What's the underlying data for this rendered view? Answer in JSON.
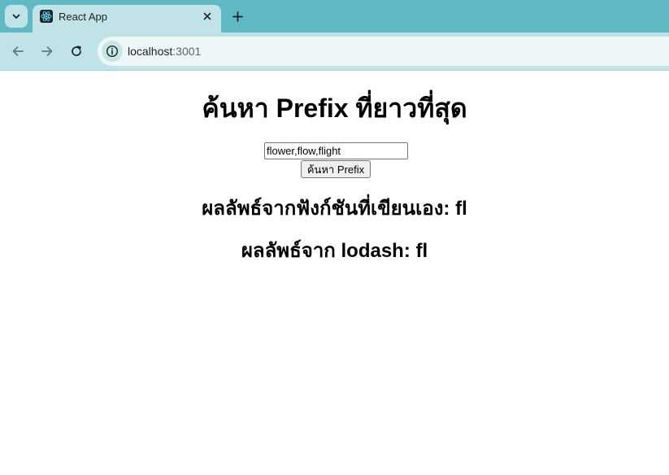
{
  "browser": {
    "tab": {
      "title": "React App",
      "favicon": "react-icon"
    },
    "address_bar": {
      "host": "localhost",
      "port": ":3001"
    },
    "icons": {
      "tab_search": "chevron-down-icon",
      "close_tab": "close-icon",
      "new_tab": "plus-icon",
      "back": "arrow-left-icon",
      "forward": "arrow-right-icon",
      "reload": "reload-icon",
      "site_info": "info-icon"
    },
    "colors": {
      "tabstrip": "#5fb8c3",
      "toolbar": "#bfe3e7",
      "omnibox": "#edf7f8"
    }
  },
  "page": {
    "title": "ค้นหา Prefix ที่ยาวที่สุด",
    "input": {
      "value": "flower,flow,flight"
    },
    "button_label": "ค้นหา Prefix",
    "result_custom": "ผลลัพธ์จากฟังก์ชันที่เขียนเอง: fl",
    "result_lodash": "ผลลัพธ์จาก lodash: fl"
  }
}
